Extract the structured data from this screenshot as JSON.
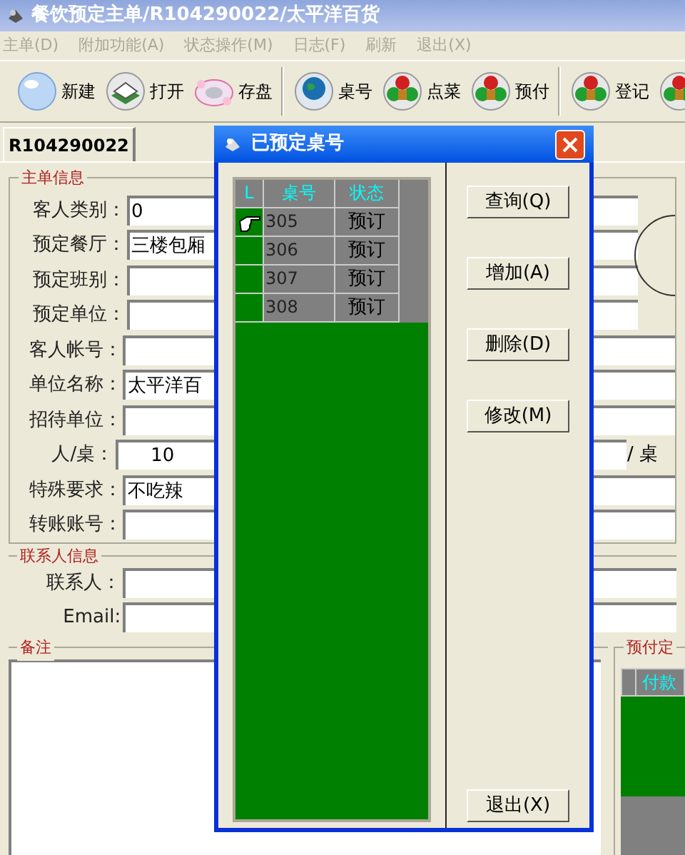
{
  "window": {
    "title": "餐饮预定主单/R104290022/太平洋百货"
  },
  "menu": [
    {
      "label": "主单(D)",
      "disabled": true
    },
    {
      "label": "附加功能(A)",
      "disabled": true
    },
    {
      "label": "状态操作(M)",
      "disabled": true
    },
    {
      "label": "日志(F)",
      "disabled": true
    },
    {
      "label": "刷新",
      "disabled": true
    },
    {
      "label": "退出(X)",
      "disabled": true
    }
  ],
  "toolbar": [
    {
      "items": [
        {
          "kind": "bubble",
          "label": "新建"
        },
        {
          "kind": "book",
          "label": "打开"
        },
        {
          "kind": "disk",
          "label": "存盘"
        }
      ]
    },
    {
      "items": [
        {
          "kind": "globe",
          "label": "桌号"
        },
        {
          "kind": "flower",
          "label": "点菜"
        },
        {
          "kind": "flower",
          "label": "预付"
        }
      ]
    },
    {
      "items": [
        {
          "kind": "flower",
          "label": "登记"
        },
        {
          "kind": "flower"
        }
      ]
    }
  ],
  "tabs": [
    {
      "label": "R104290022",
      "selected": true
    }
  ],
  "main_info": {
    "title": "主单信息",
    "fields": [
      {
        "label": "客人类别：",
        "value": "0",
        "kind": "text"
      },
      {
        "label": "预定餐厅：",
        "value": "三楼包厢",
        "kind": "text"
      },
      {
        "label": "预定班别：",
        "kind": "text"
      },
      {
        "label": "预定单位：",
        "kind": "text"
      },
      {
        "label": "客人帐号：",
        "kind": "text"
      },
      {
        "label": "单位名称：",
        "value": "太平洋百",
        "kind": "text"
      },
      {
        "label": "招待单位：",
        "kind": "text"
      },
      {
        "label": "人/桌：",
        "value": "10",
        "kind": "number",
        "suffix": "/ 桌"
      },
      {
        "label": "特殊要求：",
        "value": "不吃辣",
        "kind": "text"
      },
      {
        "label": "转账账号：",
        "kind": "text"
      }
    ]
  },
  "contact": {
    "title": "联系人信息",
    "fields": [
      {
        "label": "联系人："
      },
      {
        "label": "Email:"
      }
    ]
  },
  "notes": {
    "title": "备注"
  },
  "prepay": {
    "title": "预付定",
    "columns": [
      "付款"
    ]
  },
  "dialog": {
    "title": "已预定桌号",
    "columns": [
      "L",
      "桌号",
      "状态"
    ],
    "rows": [
      {
        "table": "305",
        "status": "预订",
        "selected": true
      },
      {
        "table": "306",
        "status": "预订",
        "selected": false
      },
      {
        "table": "307",
        "status": "预订",
        "selected": false
      },
      {
        "table": "308",
        "status": "预订",
        "selected": false
      }
    ],
    "buttons": [
      "查询(Q)",
      "增加(A)",
      "删除(D)",
      "修改(M)"
    ],
    "exit_button": "退出(X)"
  }
}
